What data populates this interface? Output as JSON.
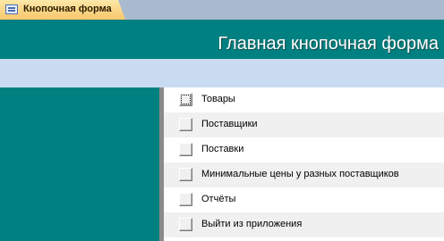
{
  "tab": {
    "icon": "form-icon",
    "label": "Кнопочная форма"
  },
  "form": {
    "title": "Главная кнопочная форма"
  },
  "menu": {
    "items": [
      {
        "label": "Товары"
      },
      {
        "label": "Поставщики"
      },
      {
        "label": "Поставки"
      },
      {
        "label": "Минимальные цены у разных поставщиков"
      },
      {
        "label": "Отчёты"
      },
      {
        "label": "Выйти из приложения"
      }
    ]
  },
  "colors": {
    "teal": "#008080",
    "subband": "#c9dbf1",
    "tab": "#f7c66a"
  }
}
